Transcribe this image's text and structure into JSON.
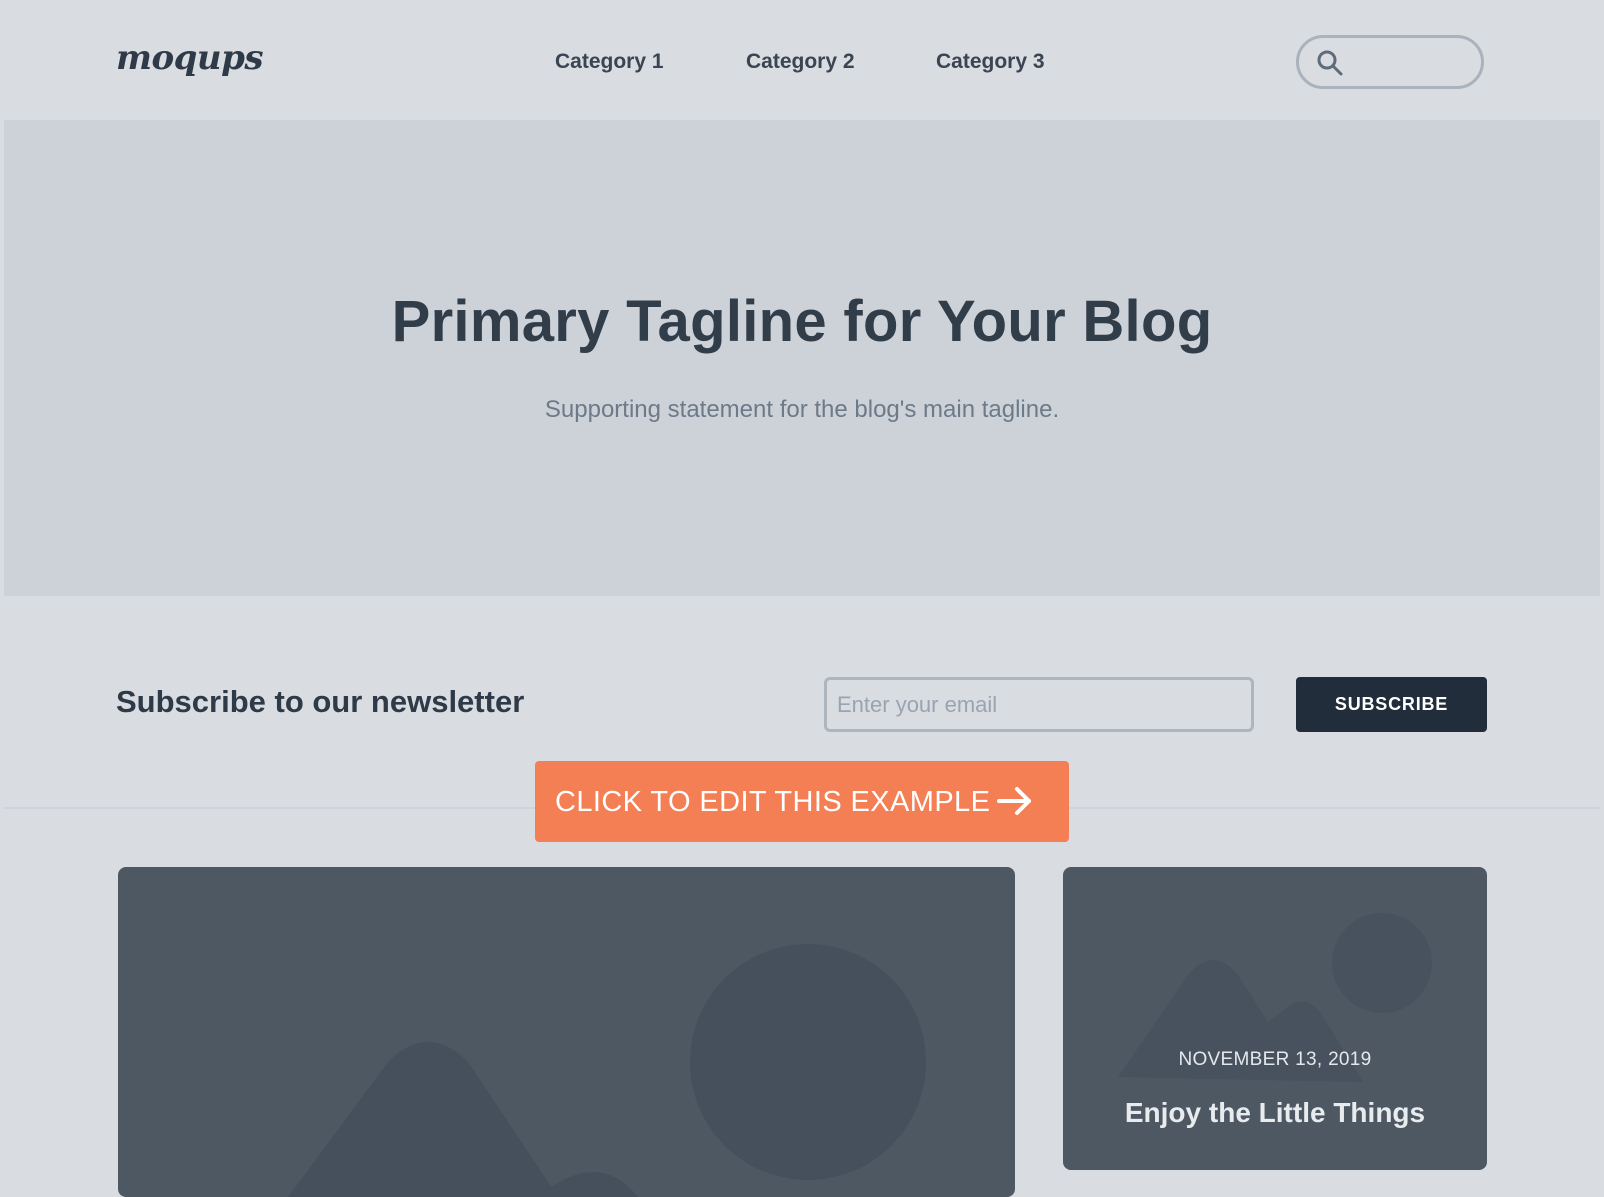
{
  "header": {
    "logo_text": "moqups",
    "nav": [
      "Category 1",
      "Category 2",
      "Category 3"
    ],
    "search": {
      "placeholder": "",
      "icon": "search-icon"
    }
  },
  "hero": {
    "title": "Primary Tagline for Your Blog",
    "subtitle": "Supporting statement for the blog's main tagline."
  },
  "newsletter": {
    "title": "Subscribe to our newsletter",
    "email_placeholder": "Enter your email",
    "button_label": "SUBSCRIBE"
  },
  "cta": {
    "label": "CLICK TO EDIT THIS EXAMPLE",
    "icon": "arrow-right-icon",
    "color": "#f47f54"
  },
  "cards": [
    {
      "type": "image-placeholder",
      "icon": "image-placeholder-icon"
    },
    {
      "type": "image-placeholder",
      "icon": "image-placeholder-icon",
      "date": "NOVEMBER 13, 2019",
      "title": "Enjoy the Little Things"
    }
  ],
  "colors": {
    "background": "#d9dce1",
    "hero": "#cdd1d8",
    "card": "#4e5863",
    "button_dark": "#222d3b",
    "accent": "#f47f54"
  }
}
